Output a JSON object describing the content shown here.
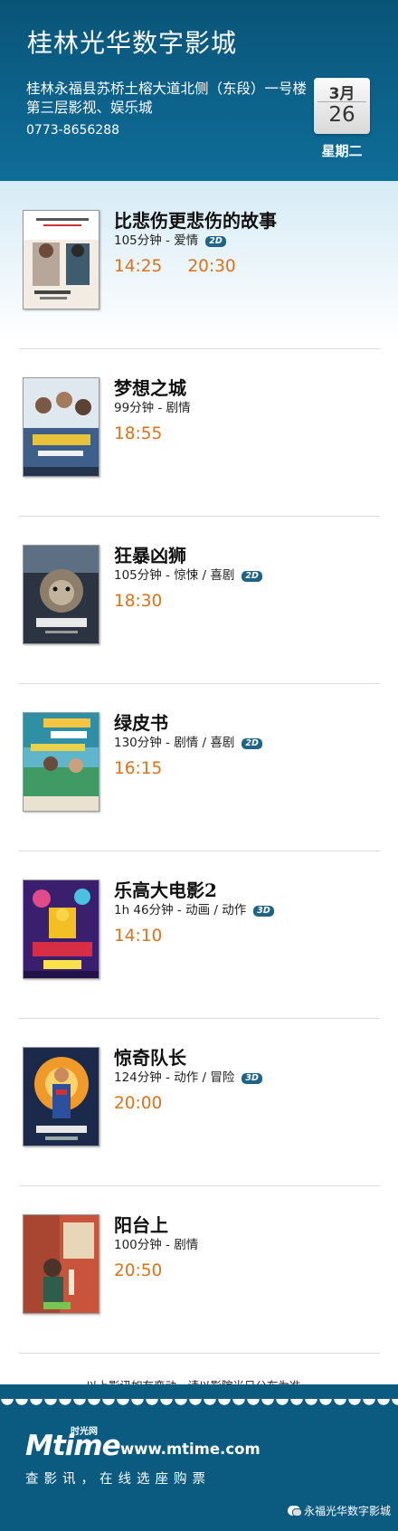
{
  "header": {
    "cinema_name": "桂林光华数字影城",
    "address": "桂林永福县苏桥土榕大道北侧（东段）一号楼第三层影视、娱乐城",
    "phone": "0773-8656288",
    "date": {
      "month": "3月",
      "day": "26",
      "weekday": "星期二"
    }
  },
  "movies": [
    {
      "title": "比悲伤更悲伤的故事",
      "meta": "105分钟 - 爱情",
      "format": "2D",
      "times": [
        "14:25",
        "20:30"
      ],
      "poster_icon": "movie-poster"
    },
    {
      "title": "梦想之城",
      "meta": "99分钟 - 剧情",
      "format": "",
      "times": [
        "18:55"
      ],
      "poster_icon": "movie-poster"
    },
    {
      "title": "狂暴凶狮",
      "meta": "105分钟 - 惊悚 / 喜剧",
      "format": "2D",
      "times": [
        "18:30"
      ],
      "poster_icon": "movie-poster"
    },
    {
      "title": "绿皮书",
      "meta": "130分钟 - 剧情 / 喜剧",
      "format": "2D",
      "times": [
        "16:15"
      ],
      "poster_icon": "movie-poster"
    },
    {
      "title": "乐高大电影2",
      "meta": "1h 46分钟 - 动画 / 动作",
      "format": "3D",
      "times": [
        "14:10"
      ],
      "poster_icon": "movie-poster"
    },
    {
      "title": "惊奇队长",
      "meta": "124分钟 - 动作 / 冒险",
      "format": "3D",
      "times": [
        "20:00"
      ],
      "poster_icon": "movie-poster"
    },
    {
      "title": "阳台上",
      "meta": "100分钟 - 剧情",
      "format": "",
      "times": [
        "20:50"
      ],
      "poster_icon": "movie-poster"
    }
  ],
  "notice": "以上影讯如有变动，请以影院当日公布为准。",
  "footer": {
    "logo_text": "Mtime",
    "logo_sub": "时光网",
    "site_url": "www.mtime.com",
    "slogan": "查影讯，在线选座购票",
    "wechat_account": "永福光华数字影城"
  },
  "colors": {
    "header_bg": "#0c6189",
    "time_accent": "#d9731c",
    "badge_bg": "#1f6485"
  }
}
